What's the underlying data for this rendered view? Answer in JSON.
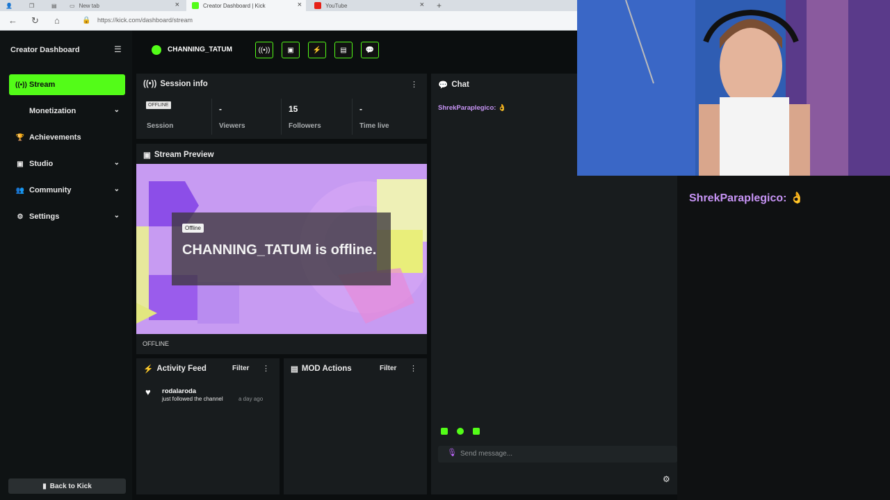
{
  "browser": {
    "tabs": [
      {
        "label": "New tab",
        "active": false
      },
      {
        "label": "Creator Dashboard | Kick",
        "active": true
      },
      {
        "label": "YouTube",
        "active": false
      }
    ],
    "url": "https://kick.com/dashboard/stream"
  },
  "sidebar": {
    "title": "Creator Dashboard",
    "items": [
      {
        "label": "Stream",
        "icon": "broadcast-icon",
        "active": true,
        "expandable": false
      },
      {
        "label": "Monetization",
        "icon": "dollar-icon",
        "active": false,
        "expandable": true
      },
      {
        "label": "Achievements",
        "icon": "trophy-icon",
        "active": false,
        "expandable": false
      },
      {
        "label": "Studio",
        "icon": "studio-icon",
        "active": false,
        "expandable": true
      },
      {
        "label": "Community",
        "icon": "community-icon",
        "active": false,
        "expandable": true
      },
      {
        "label": "Settings",
        "icon": "gear-icon",
        "active": false,
        "expandable": true
      }
    ],
    "back_label": "Back to Kick"
  },
  "topbar": {
    "channel_name": "CHANNING_TATUM"
  },
  "session": {
    "title": "Session info",
    "status_chip": "OFFLINE",
    "stats": [
      {
        "value": "",
        "label": "Session"
      },
      {
        "value": "-",
        "label": "Viewers"
      },
      {
        "value": "15",
        "label": "Followers"
      },
      {
        "value": "-",
        "label": "Time live"
      }
    ]
  },
  "preview": {
    "title": "Stream Preview",
    "chip": "Offline",
    "message": "CHANNING_TATUM is offline.",
    "footer": "OFFLINE"
  },
  "activity": {
    "title": "Activity Feed",
    "filter": "Filter",
    "items": [
      {
        "name": "rodalaroda",
        "desc": "just followed the channel",
        "time": "a day ago"
      }
    ]
  },
  "mod": {
    "title": "MOD Actions",
    "filter": "Filter"
  },
  "chat": {
    "title": "Chat",
    "message": "ShrekParaplegico: 👌",
    "placeholder": "Send message..."
  },
  "overlay": {
    "message": "ShrekParaplegico: 👌"
  },
  "colors": {
    "accent": "#53fc18",
    "username": "#c794f5",
    "panel": "#181c1e",
    "background": "#0b0e0f"
  }
}
